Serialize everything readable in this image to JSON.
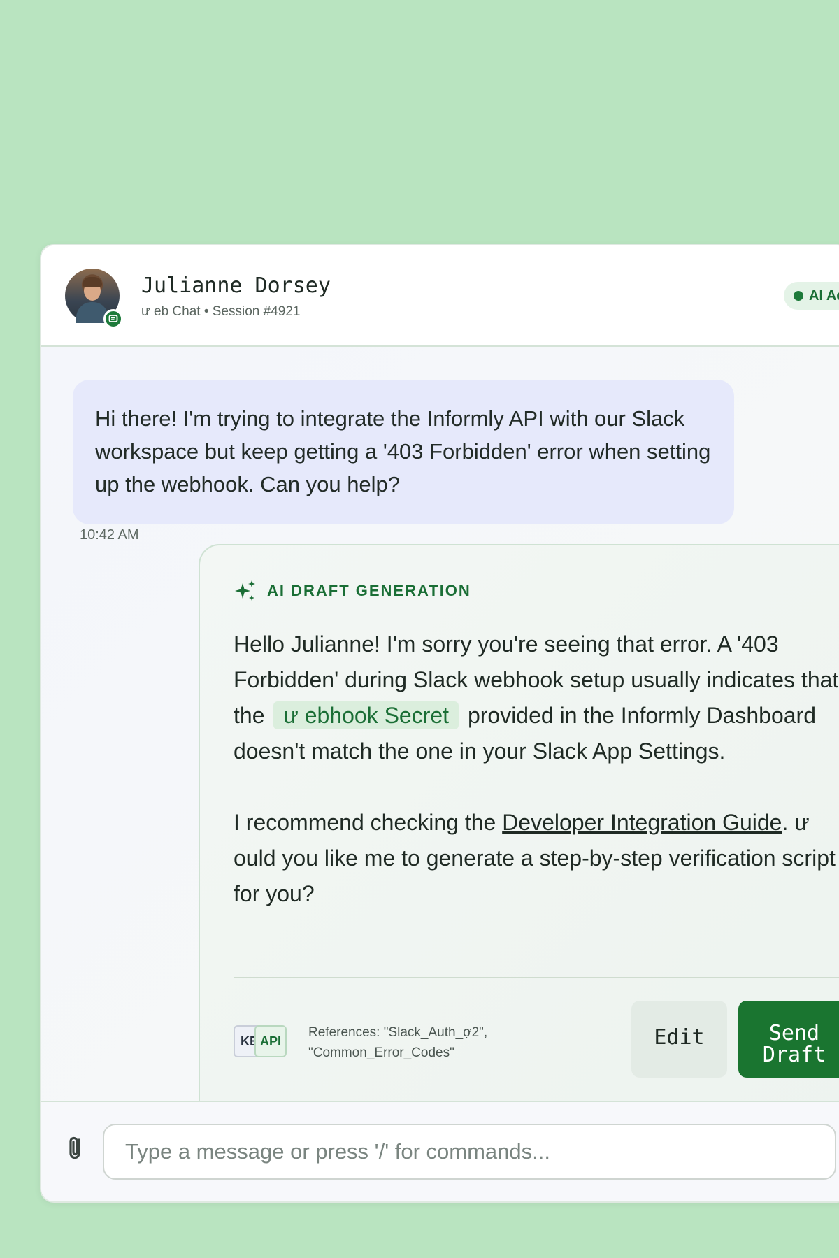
{
  "header": {
    "contact_name": "Julianne Dorsey",
    "channel_line": "ư eb Chat • Session #4921",
    "status_label": "AI Active",
    "avatar_badge_icon": "chat-icon"
  },
  "messages": {
    "user": {
      "text": "Hi there! I'm trying to integrate the Informly API with our Slack workspace but keep getting a '403 Forbidden' error when setting up the webhook. Can you help?",
      "timestamp": "10:42 AM"
    },
    "ai_draft": {
      "label": "AI DRAFT GENERATION",
      "para1_before": "Hello Julianne! I'm sorry you're seeing that error. A '403 Forbidden' during Slack webhook setup usually indicates that the",
      "chip": "ư ebhook Secret",
      "para1_after": "provided in the Informly Dashboard doesn't match the one in your Slack App Settings.",
      "para2_before": "I recommend checking the ",
      "link": "Developer Integration Guide",
      "para2_after": ". ư ould you like me to generate a step-by-step verification script for you?",
      "ref_badge_kb": "KB",
      "ref_badge_api": "API",
      "references": "References: \"Slack_Auth_ợ2\", \"Common_Error_Codes\"",
      "edit_label": "Edit",
      "send_label": "Send Draft"
    }
  },
  "composer": {
    "placeholder": "Type a message or press '/' for commands...",
    "value": ""
  },
  "colors": {
    "page_bg": "#b9e4c0",
    "accent_green": "#1a7530",
    "user_bubble": "#e6e9fb"
  }
}
